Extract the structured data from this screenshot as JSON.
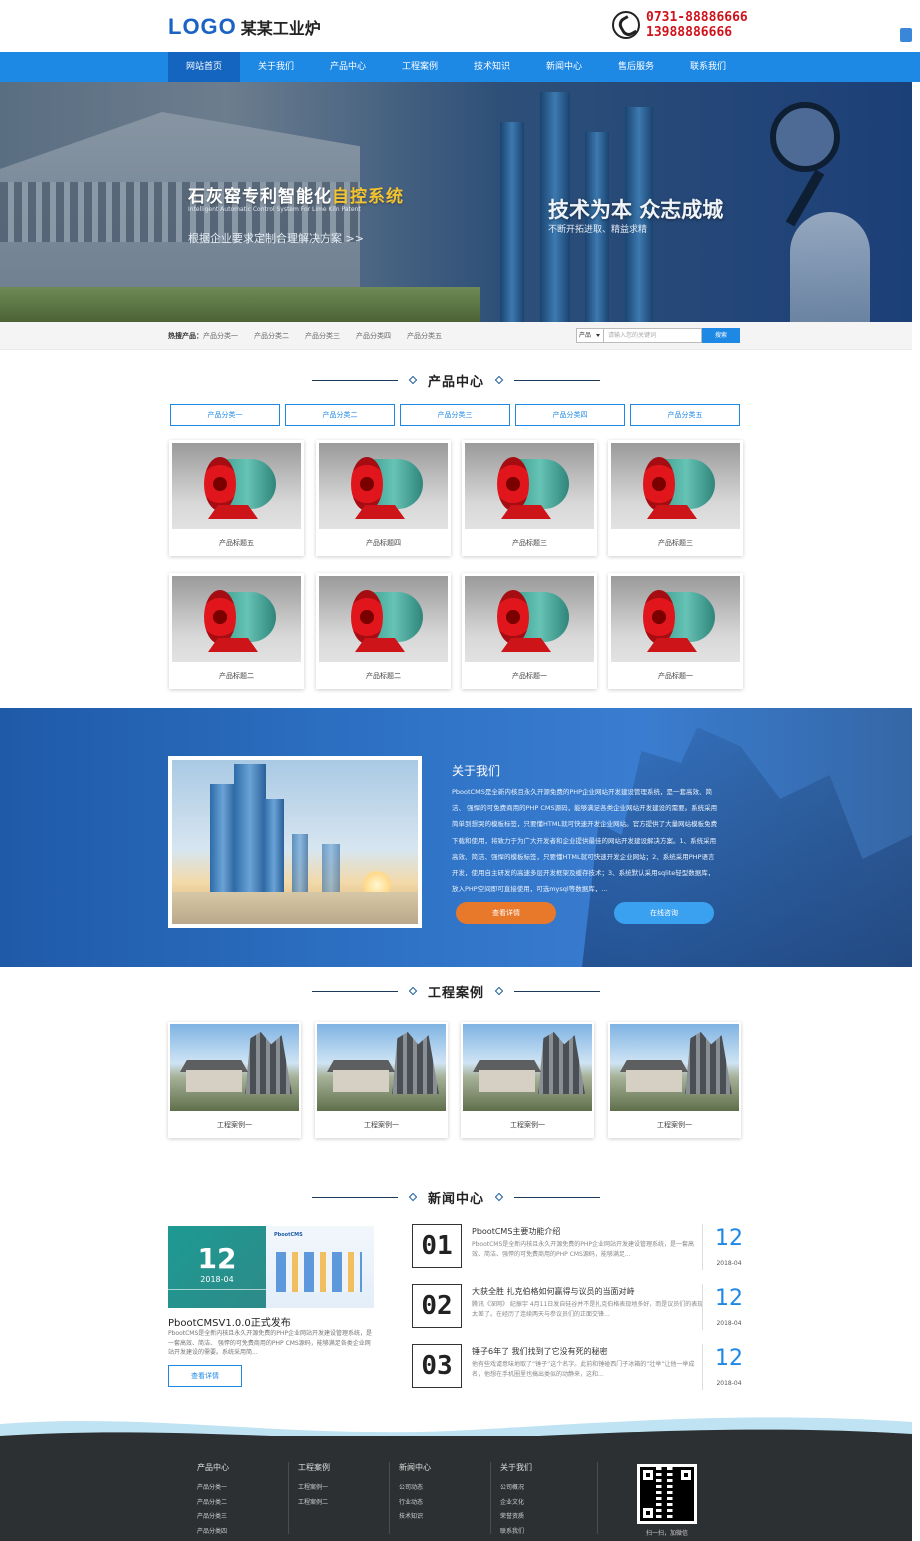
{
  "header": {
    "logo_mark": "LOGO",
    "company": "某某工业炉",
    "phone1": "0731-88886666",
    "phone2": "13988886666"
  },
  "nav": [
    "网站首页",
    "关于我们",
    "产品中心",
    "工程案例",
    "技术知识",
    "新闻中心",
    "售后服务",
    "联系我们"
  ],
  "banner": {
    "title_main": "石灰窑专利智能化",
    "title_highlight": "自控系统",
    "title_en": "Intelligent Automatic Control System For Lime Kiln Patent",
    "subtitle": "根据企业要求定制合理解决方案 >>",
    "slogan": "技术为本 众志成城",
    "slogan_sub": "不断开拓进取、精益求精"
  },
  "hot": {
    "label": "热搜产品：",
    "items": [
      "产品分类一",
      "产品分类二",
      "产品分类三",
      "产品分类四",
      "产品分类五"
    ]
  },
  "search": {
    "select_value": "产品",
    "placeholder": "请输入您的关键词",
    "button": "搜索"
  },
  "products": {
    "title": "产品中心",
    "categories": [
      "产品分类一",
      "产品分类二",
      "产品分类三",
      "产品分类四",
      "产品分类五"
    ],
    "items": [
      "产品标题五",
      "产品标题四",
      "产品标题三",
      "产品标题三",
      "产品标题二",
      "产品标题二",
      "产品标题一",
      "产品标题一"
    ]
  },
  "about": {
    "title": "关于我们",
    "text": "PbootCMS是全新内核且永久开源免费的PHP企业网站开发建设管理系统，是一套高效、简洁、 强悍的可免费商用的PHP CMS源码，能够满足各类企业网站开发建设的需要。系统采用简单到想哭的模板标签，只要懂HTML就可快速开发企业网站。官方提供了大量网站模板免费下载和使用，将致力于为广大开发者和企业提供最佳的网站开发建设解决方案。1、系统采用高效、简洁、强悍的模板标签，只要懂HTML就可快速开发企业网站；2、系统采用PHP语言开发，使用自主研发的高速多层开发框架及缓存技术；3、系统默认采用sqlite轻型数据库，放入PHP空间即可直接使用，可选mysql等数据库，...",
    "btn_more": "查看详情",
    "btn_consult": "在线咨询"
  },
  "cases": {
    "title": "工程案例",
    "items": [
      "工程案例一",
      "工程案例一",
      "工程案例一",
      "工程案例一"
    ]
  },
  "news": {
    "title": "新闻中心",
    "featured": {
      "day": "12",
      "ym": "2018-04",
      "title": "PbootCMSV1.0.0正式发布",
      "text": "PbootCMS是全新内核且永久开源免费的PHP企业网站开发建设管理系统，是一套高效、简洁、 强悍的可免费商用的PHP CMS源码，能够满足各类企业网站开发建设的需要。系统采用简...",
      "button": "查看详情"
    },
    "items": [
      {
        "num": "01",
        "title": "PbootCMS主要功能介绍",
        "desc": "PbootCMS是全新内核且永久开源免费的PHP企业网站开发建设管理系统，是一套高效、简洁、强悍的可免费商用的PHP CMS源码，能够满足...",
        "day": "12",
        "ym": "2018-04"
      },
      {
        "num": "02",
        "title": "大获全胜 扎克伯格如何赢得与议员的当面对峙",
        "desc": "腾讯《深网》 纪振宇 4月11日发自硅谷并不是扎克伯格表现地多好，而是议员们的表现太差了。在经历了连续两天与参议员们的正面交锋...",
        "day": "12",
        "ym": "2018-04"
      },
      {
        "num": "03",
        "title": "锤子6年了 我们找到了它没有死的秘密",
        "desc": "他有些戏谑意味地取了“锤子”这个名字。此前和锤碰西门子冰箱的“壮举”让他一举成名，他想在手机圈里也搞出类似的动静来，这和...",
        "day": "12",
        "ym": "2018-04"
      }
    ]
  },
  "footer": {
    "cols": [
      {
        "title": "产品中心",
        "items": [
          "产品分类一",
          "产品分类二",
          "产品分类三",
          "产品分类四"
        ]
      },
      {
        "title": "工程案例",
        "items": [
          "工程案例一",
          "工程案例二"
        ]
      },
      {
        "title": "新闻中心",
        "items": [
          "公司动态",
          "行业动态",
          "技术知识"
        ]
      },
      {
        "title": "关于我们",
        "items": [
          "公司概况",
          "企业文化",
          "荣誉资质",
          "联系我们"
        ]
      }
    ],
    "qr_caption": "扫一扫，加微信"
  }
}
